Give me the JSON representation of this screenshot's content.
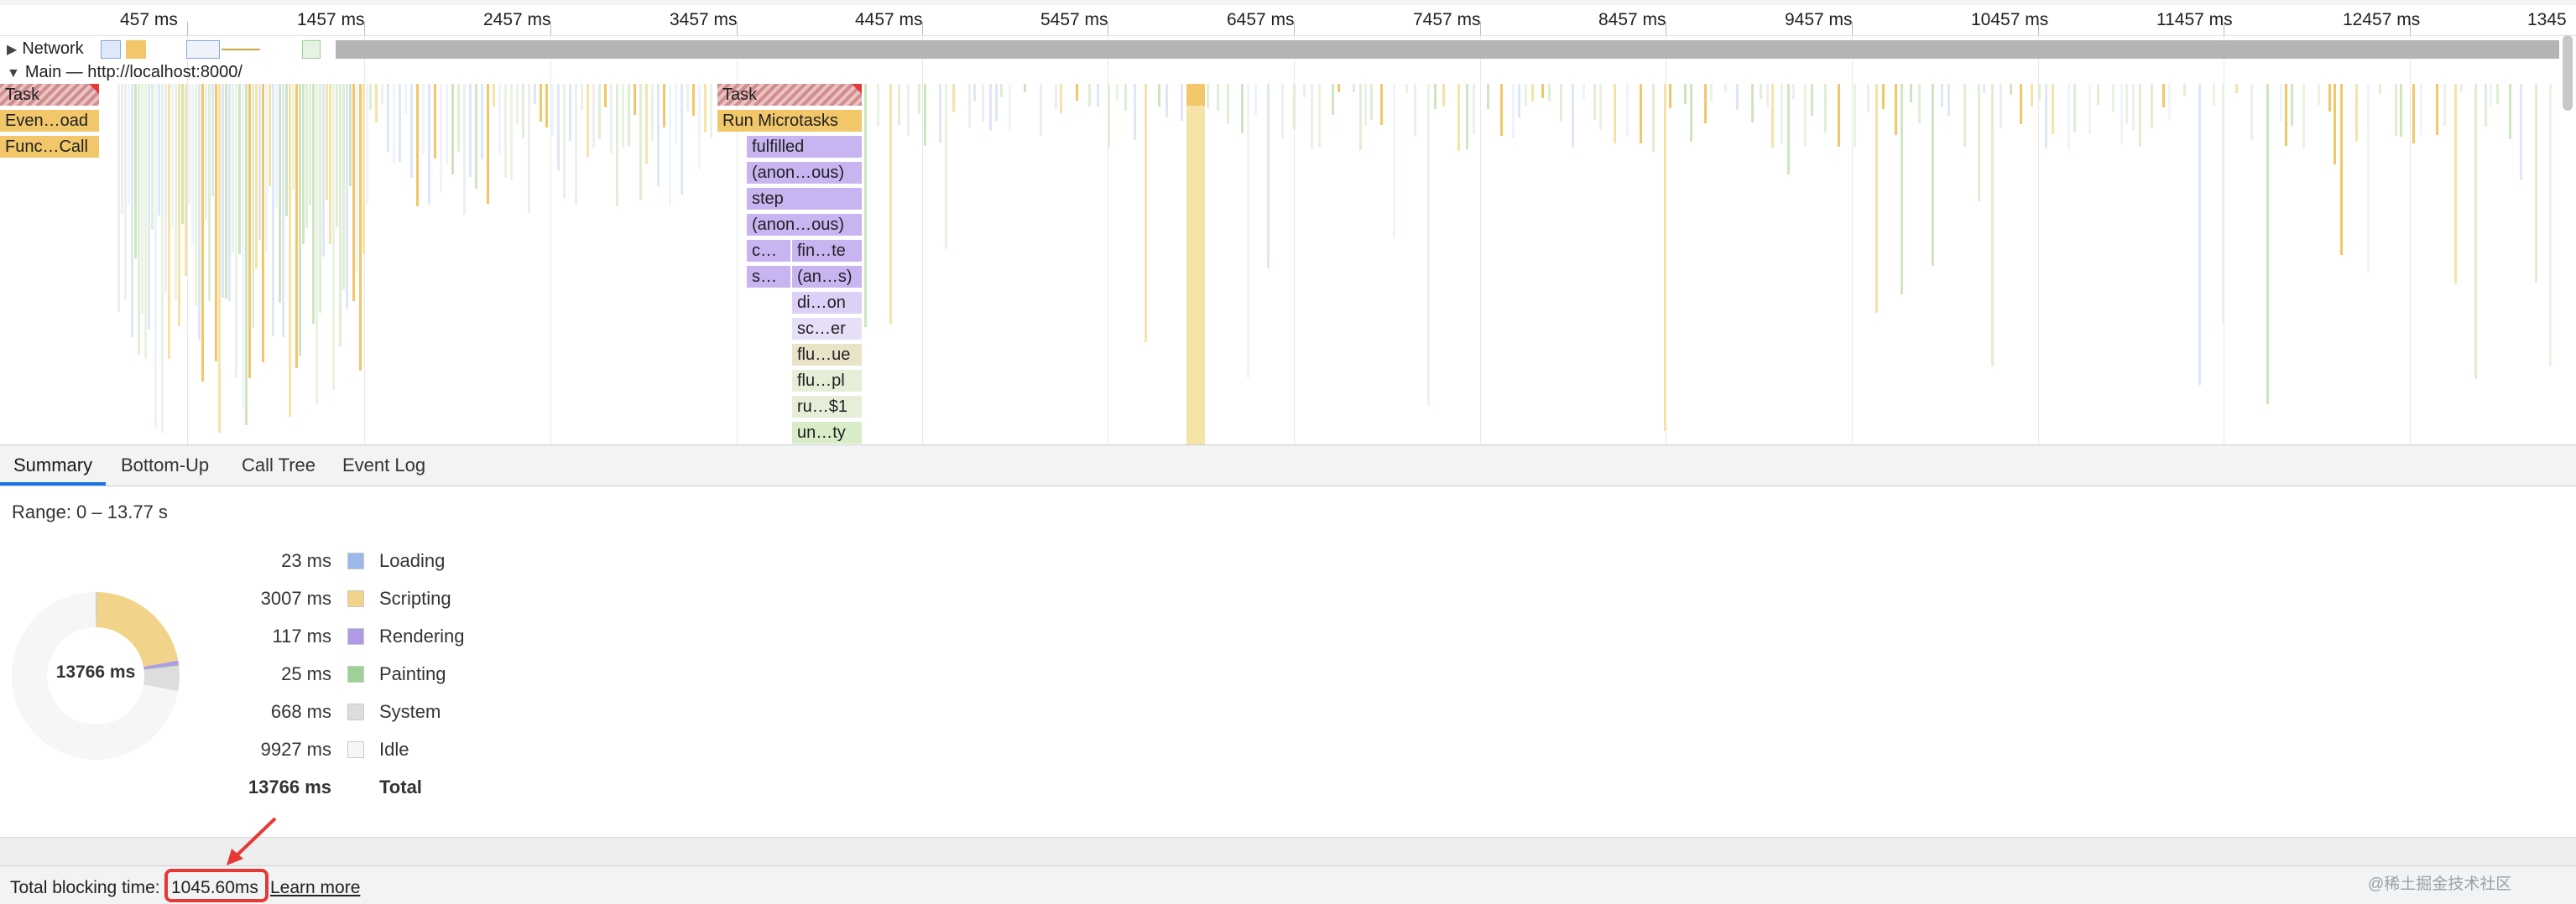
{
  "timeline": {
    "ticks": [
      "457 ms",
      "1457 ms",
      "2457 ms",
      "3457 ms",
      "4457 ms",
      "5457 ms",
      "6457 ms",
      "7457 ms",
      "8457 ms",
      "9457 ms",
      "10457 ms",
      "11457 ms",
      "12457 ms",
      "1345"
    ],
    "network_label": "Network",
    "main_label": "Main — http://localhost:8000/",
    "left_stack": [
      "Task",
      "Even…oad",
      "Func…Call"
    ],
    "center_stack": [
      "Task",
      "Run Microtasks",
      "fulfilled",
      "(anon…ous)",
      "step",
      "(anon…ous)"
    ],
    "split_left": [
      "c…",
      "s…"
    ],
    "split_right": [
      "fin…te",
      "(an…s)",
      "di…on",
      "sc…er",
      "flu…ue",
      "flu…pl",
      "ru…$1",
      "un…ty"
    ]
  },
  "tabs": [
    {
      "label": "Summary",
      "active": true
    },
    {
      "label": "Bottom-Up",
      "active": false
    },
    {
      "label": "Call Tree",
      "active": false
    },
    {
      "label": "Event Log",
      "active": false
    }
  ],
  "summary": {
    "range": "Range: 0 – 13.77 s",
    "donut_center": "13766 ms",
    "legend": [
      {
        "value": "23 ms",
        "label": "Loading",
        "color": "#9bb8ea",
        "ms": 23
      },
      {
        "value": "3007 ms",
        "label": "Scripting",
        "color": "#f1d38a",
        "ms": 3007
      },
      {
        "value": "117 ms",
        "label": "Rendering",
        "color": "#af9ae8",
        "ms": 117
      },
      {
        "value": "25 ms",
        "label": "Painting",
        "color": "#9dd196",
        "ms": 25
      },
      {
        "value": "668 ms",
        "label": "System",
        "color": "#dddddd",
        "ms": 668
      },
      {
        "value": "9927 ms",
        "label": "Idle",
        "color": "#f6f6f6",
        "ms": 9927
      }
    ],
    "total_value": "13766 ms",
    "total_label": "Total"
  },
  "footer": {
    "tbt_label": "Total blocking time:",
    "tbt_value": "1045.60ms",
    "learn_more": "Learn more",
    "watermark": "@稀土掘金技术社区"
  }
}
